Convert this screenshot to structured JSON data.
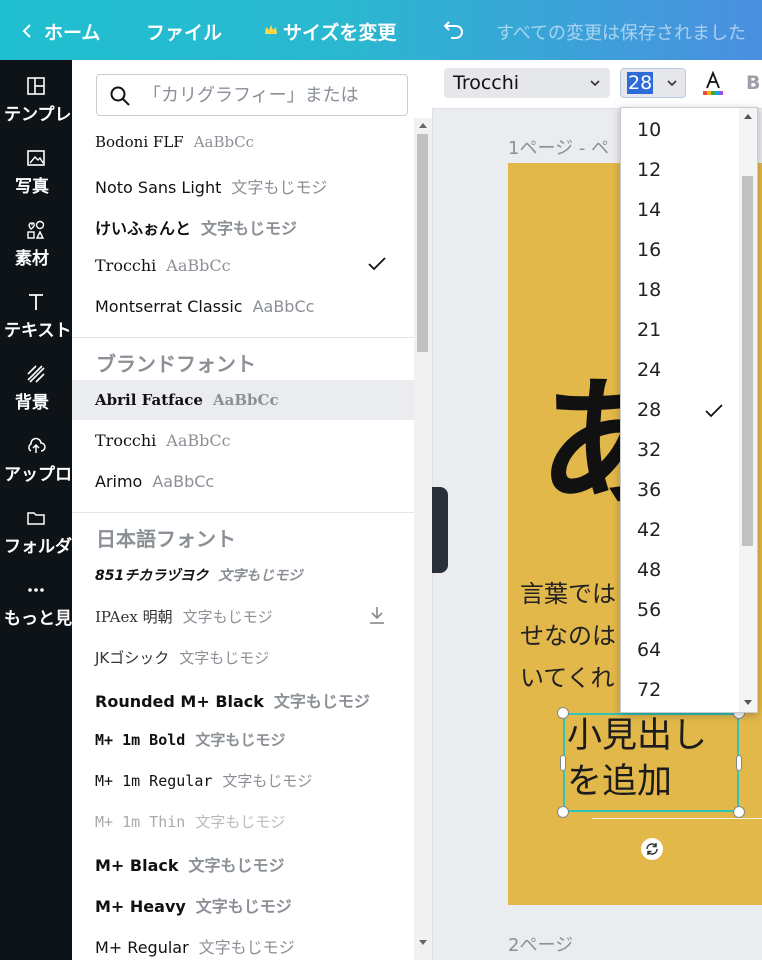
{
  "topbar": {
    "home": "ホーム",
    "file": "ファイル",
    "resize": "サイズを変更",
    "saved_status": "すべての変更は保存されました"
  },
  "leftnav": {
    "items": [
      {
        "label": "テンプレート",
        "icon": "template-icon"
      },
      {
        "label": "写真",
        "icon": "photo-icon"
      },
      {
        "label": "素材",
        "icon": "elements-icon"
      },
      {
        "label": "テキスト",
        "icon": "text-icon"
      },
      {
        "label": "背景",
        "icon": "background-icon"
      },
      {
        "label": "アップロード",
        "icon": "upload-icon"
      },
      {
        "label": "フォルダ",
        "icon": "folder-icon"
      },
      {
        "label": "もっと見る",
        "icon": "more-icon"
      }
    ]
  },
  "font_panel": {
    "search_placeholder": "「カリグラフィー」または",
    "recent_fonts": [
      {
        "name": "Bodoni FLF",
        "sample": "AaBbCc"
      },
      {
        "name": "Noto Sans Light",
        "sample": "文字もじモジ"
      },
      {
        "name": "けいふぉんと",
        "sample": "文字もじモジ"
      },
      {
        "name": "Trocchi",
        "sample": "AaBbCc"
      },
      {
        "name": "Montserrat Classic",
        "sample": "AaBbCc"
      }
    ],
    "brand_heading": "ブランドフォント",
    "brand_fonts": [
      {
        "name": "Abril Fatface",
        "sample": "AaBbCc"
      },
      {
        "name": "Trocchi",
        "sample": "AaBbCc"
      },
      {
        "name": "Arimo",
        "sample": "AaBbCc"
      }
    ],
    "japanese_heading": "日本語フォント",
    "japanese_fonts": [
      {
        "name": "851チカラヅヨク",
        "sample": "文字もじモジ"
      },
      {
        "name": "IPAex 明朝",
        "sample": "文字もじモジ"
      },
      {
        "name": "JKゴシック",
        "sample": "文字もじモジ"
      },
      {
        "name": "Rounded M+ Black",
        "sample": "文字もじモジ"
      },
      {
        "name": "M+ 1m Bold",
        "sample": "文字もじモジ"
      },
      {
        "name": "M+ 1m Regular",
        "sample": "文字もじモジ"
      },
      {
        "name": "M+ 1m Thin",
        "sample": "文字もじモジ"
      },
      {
        "name": "M+ Black",
        "sample": "文字もじモジ"
      },
      {
        "name": "M+ Heavy",
        "sample": "文字もじモジ"
      },
      {
        "name": "M+ Regular",
        "sample": "文字もじモジ"
      }
    ]
  },
  "toolbar": {
    "font_name": "Trocchi",
    "font_size": "28",
    "bold_label": "B"
  },
  "size_dropdown": {
    "options": [
      "10",
      "12",
      "14",
      "16",
      "18",
      "21",
      "24",
      "28",
      "32",
      "36",
      "42",
      "48",
      "56",
      "64",
      "72"
    ],
    "selected": "28"
  },
  "canvas": {
    "page1_label": "1ページ - ペ",
    "page2_label": "2ページ",
    "big_char": "あ",
    "body_lines": [
      "言葉では",
      "せなのは",
      "いてくれ"
    ],
    "heading_lines": [
      "小見出し",
      "を追加"
    ],
    "page_color": "#e3b84a"
  },
  "colors": {
    "topbar_start": "#1fbfcf",
    "topbar_end": "#4a8fe0",
    "selection": "#2ec4b6",
    "highlight": "#2d6bd8"
  }
}
